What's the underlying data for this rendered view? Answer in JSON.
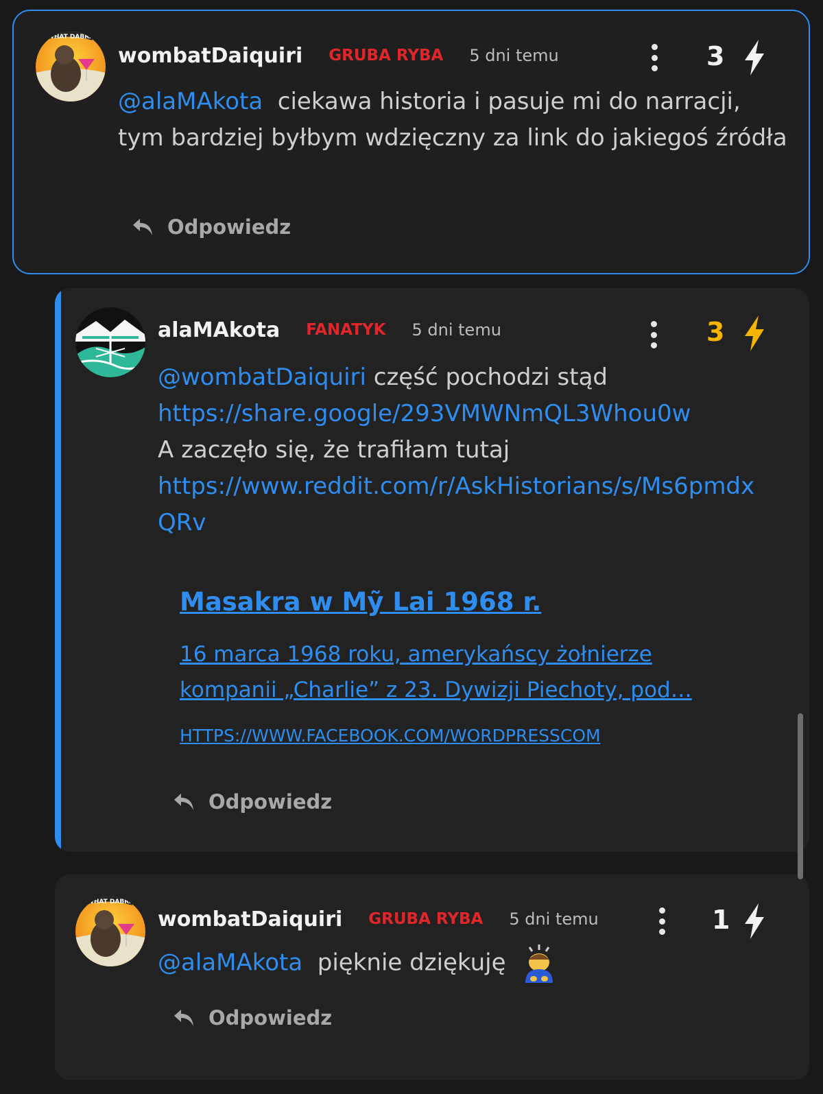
{
  "comments": [
    {
      "username": "wombatDaiquiri",
      "rank": "GRUBA RYBA",
      "time": "5 dni temu",
      "score": "3",
      "mention": "@alaMAkota",
      "text": "ciekawa historia i pasuje mi do narracji, tym bardziej byłbym wdzięczny za link do jakiegoś źródła",
      "reply_label": "Odpowiedz",
      "highlighted": true,
      "avatar_text": "WHAT DABRA"
    },
    {
      "username": "alaMAkota",
      "rank": "FANATYK",
      "time": "5 dni temu",
      "score": "3",
      "mention": "@wombatDaiquiri",
      "text_1": "część pochodzi stąd",
      "link_1": "https://share.google/293VMWNmQL3Whou0w",
      "text_2": "A zaczęło się, że trafiłam tutaj",
      "link_2": "https://www.reddit.com/r/AskHistorians/s/Ms6pmdxQRv",
      "preview": {
        "title": "Masakra w Mỹ Lai 1968 r.",
        "description": "16 marca 1968 roku, amerykańscy żołnierze kompanii „Charlie” z 23. Dywizji Piechoty, pod…",
        "url": "HTTPS://WWW.FACEBOOK.COM/WORDPRESSCOM"
      },
      "reply_label": "Odpowiedz"
    },
    {
      "username": "wombatDaiquiri",
      "rank": "GRUBA RYBA",
      "time": "5 dni temu",
      "score": "1",
      "mention": "@alaMAkota",
      "text": "pięknie dziękuję",
      "emoji": "person-bowing",
      "reply_label": "Odpowiedz",
      "avatar_text": "WHAT DABRA"
    }
  ],
  "colors": {
    "accent": "#2f8df0",
    "rank": "#e0262b",
    "score_highlight": "#f5b400",
    "background": "#191919"
  },
  "icons": [
    "more-vertical-icon",
    "lightning-bolt-icon",
    "reply-arrow-icon"
  ]
}
